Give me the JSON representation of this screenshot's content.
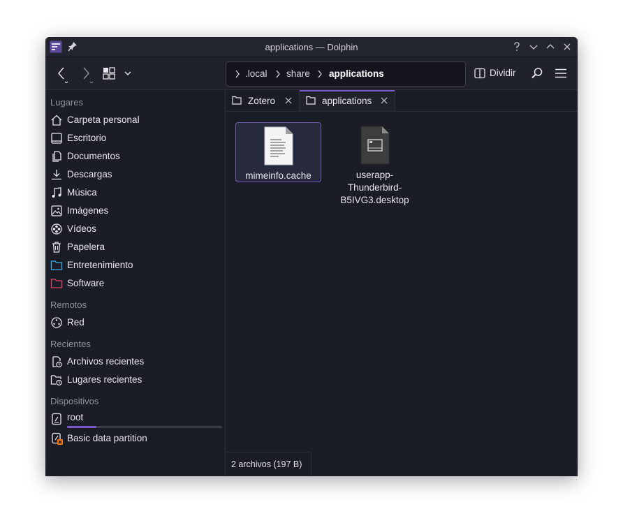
{
  "window": {
    "title": "applications — Dolphin"
  },
  "titlebar_buttons": [
    "help",
    "minimize",
    "maximize",
    "close"
  ],
  "toolbar": {
    "breadcrumb": [
      ".local",
      "share",
      "applications"
    ],
    "split_label": "Dividir"
  },
  "sidebar": {
    "sections": {
      "places": "Lugares",
      "remote": "Remotos",
      "recent": "Recientes",
      "devices": "Dispositivos"
    },
    "places": [
      {
        "label": "Carpeta personal",
        "icon": "home-icon"
      },
      {
        "label": "Escritorio",
        "icon": "desktop-icon"
      },
      {
        "label": "Documentos",
        "icon": "documents-icon"
      },
      {
        "label": "Descargas",
        "icon": "downloads-icon"
      },
      {
        "label": "Música",
        "icon": "music-icon"
      },
      {
        "label": "Imágenes",
        "icon": "pictures-icon"
      },
      {
        "label": "Vídeos",
        "icon": "videos-icon"
      },
      {
        "label": "Papelera",
        "icon": "trash-icon"
      },
      {
        "label": "Entretenimiento",
        "icon": "folder-blue-icon"
      },
      {
        "label": "Software",
        "icon": "folder-red-icon"
      }
    ],
    "remote": [
      {
        "label": "Red",
        "icon": "network-icon"
      }
    ],
    "recent": [
      {
        "label": "Archivos recientes",
        "icon": "recent-files-icon"
      },
      {
        "label": "Lugares recientes",
        "icon": "recent-places-icon"
      }
    ],
    "devices": [
      {
        "label": "root",
        "icon": "drive-icon",
        "usage": 0.19
      },
      {
        "label": "Basic data partition",
        "icon": "drive-warning-icon"
      }
    ]
  },
  "tabs": [
    {
      "label": "Zotero",
      "active": false
    },
    {
      "label": "applications",
      "active": true
    }
  ],
  "files": [
    {
      "name": "mimeinfo.cache",
      "lines": [
        "mimeinfo.cache"
      ],
      "selected": true
    },
    {
      "name": "userapp-Thunderbird-B5IVG3.desktop",
      "lines": [
        "userapp-",
        "Thunderbird-",
        "B5IVG3.desktop"
      ],
      "selected": false
    }
  ],
  "status": {
    "text": "2 archivos (197 B)"
  },
  "colors": {
    "accent": "#7b58c9",
    "window_bg": "#1b1d26",
    "folder_blue": "#3daee9",
    "folder_red": "#e0435b"
  }
}
